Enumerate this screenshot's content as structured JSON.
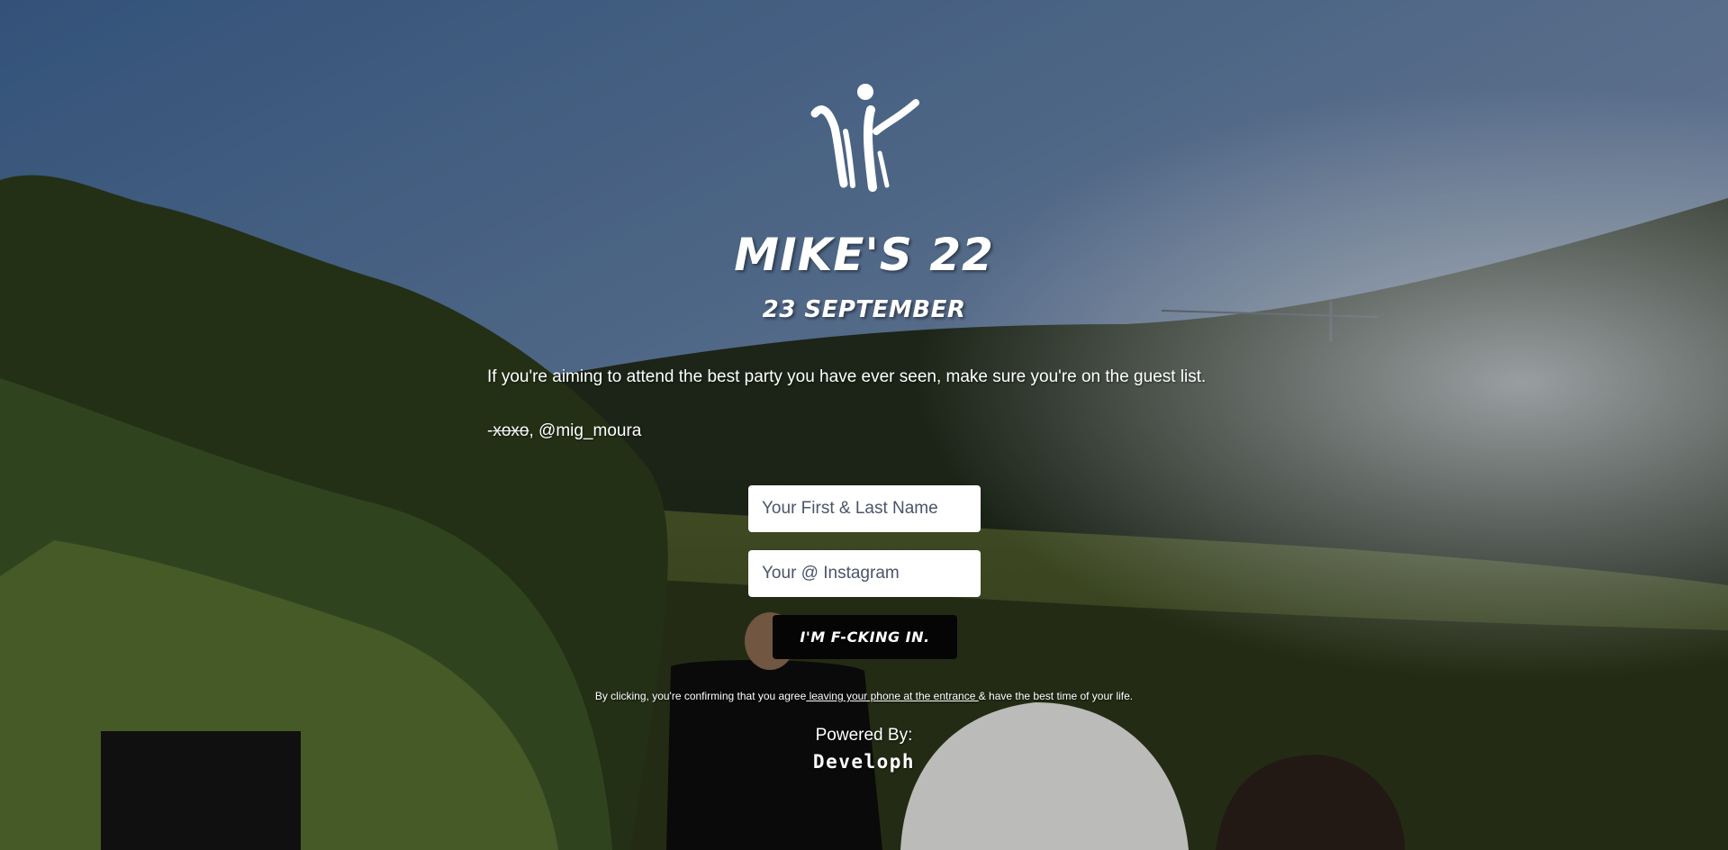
{
  "event": {
    "title": "MIKE'S 22",
    "date": "23 SEPTEMBER"
  },
  "intro": {
    "text": "If you're aiming to attend the best party you have ever seen, make sure you're on the guest list."
  },
  "signature": {
    "prefix": "-",
    "struck": "xoxo",
    "handle": ", @mig_moura"
  },
  "form": {
    "name_placeholder": "Your First & Last Name",
    "name_value": "",
    "instagram_placeholder": "Your @ Instagram",
    "instagram_value": "",
    "submit_label": "I'M F-CKING IN."
  },
  "disclaimer": {
    "before": "By clicking, you're confirming that you agree",
    "link": " leaving your phone at the entrance ",
    "after": "& have the best time of your life."
  },
  "footer": {
    "powered_label": "Powered By:",
    "brand": "Developh"
  },
  "icons": {
    "logo": "dancing-figure-logo-icon"
  },
  "colors": {
    "text": "#ffffff",
    "button_bg": "#050505",
    "input_bg": "#ffffff",
    "placeholder": "#4a5568"
  }
}
